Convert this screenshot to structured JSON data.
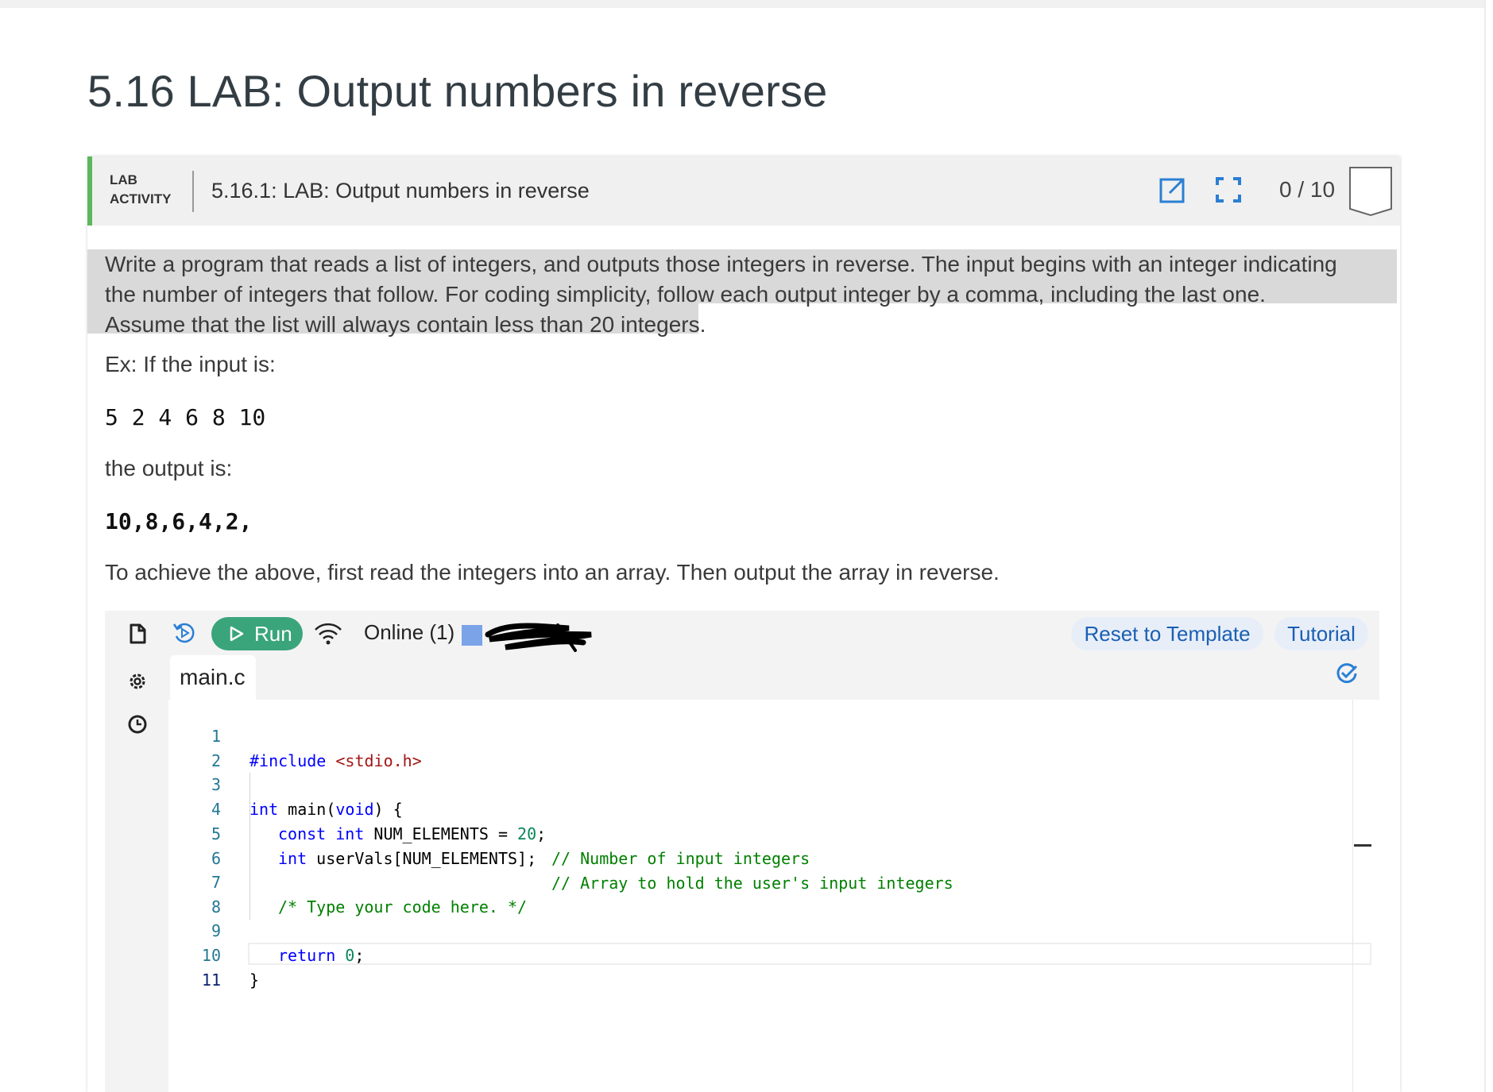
{
  "page": {
    "title": "5.16 LAB: Output numbers in reverse"
  },
  "activity": {
    "label_line1": "LAB",
    "label_line2": "ACTIVITY",
    "title": "5.16.1: LAB: Output numbers in reverse",
    "score": "0 / 10",
    "icons": [
      "external-link-icon",
      "fullscreen-icon",
      "completion-badge-icon"
    ]
  },
  "description": {
    "text": "Write a program that reads a list of integers, and outputs those integers in reverse. The input begins with an integer indicating the number of integers that follow. For coding simplicity, follow each output integer by a comma, including the last one. Assume that the list will always contain less than 20 integers.",
    "input_intro": "Ex: If the input is:",
    "input_example": "5 2 4 6 8 10",
    "output_intro": "the output is:",
    "output_example": "10,8,6,4,2,",
    "hint": "To achieve the above, first read the integers into an array. Then output the array in reverse."
  },
  "ide": {
    "run_label": "Run",
    "online_status": "Online (1)",
    "reset_label": "Reset to Template",
    "tutorial_label": "Tutorial",
    "file_tab": "main.c",
    "sidebar_icons": [
      "file-icon",
      "settings-icon",
      "history-icon"
    ],
    "toolbar_icons": [
      "reset-code-icon",
      "wifi-icon",
      "saved-check-icon"
    ],
    "line_numbers": [
      "1",
      "2",
      "3",
      "4",
      "5",
      "6",
      "7",
      "8",
      "9",
      "10",
      "11"
    ],
    "code": {
      "l1_directive": "#include",
      "l1_header": "<stdio.h>",
      "l3_type": "int",
      "l3_main": " main(",
      "l3_void": "void",
      "l3_rest": ") {",
      "l4_const": "const",
      "l4_int": "int",
      "l4_name": " NUM_ELEMENTS = ",
      "l4_value": "20",
      "l4_semi": ";",
      "l4_comment": "// Number of input integers",
      "l5_int": "int",
      "l5_rest": " userVals[NUM_ELEMENTS];",
      "l5_comment": "// Array to hold the user's input integers",
      "l7_comment": "/* Type your code here. */",
      "l9_return": "return",
      "l9_zero": "0",
      "l9_semi": ";",
      "l10_close": "}"
    }
  }
}
